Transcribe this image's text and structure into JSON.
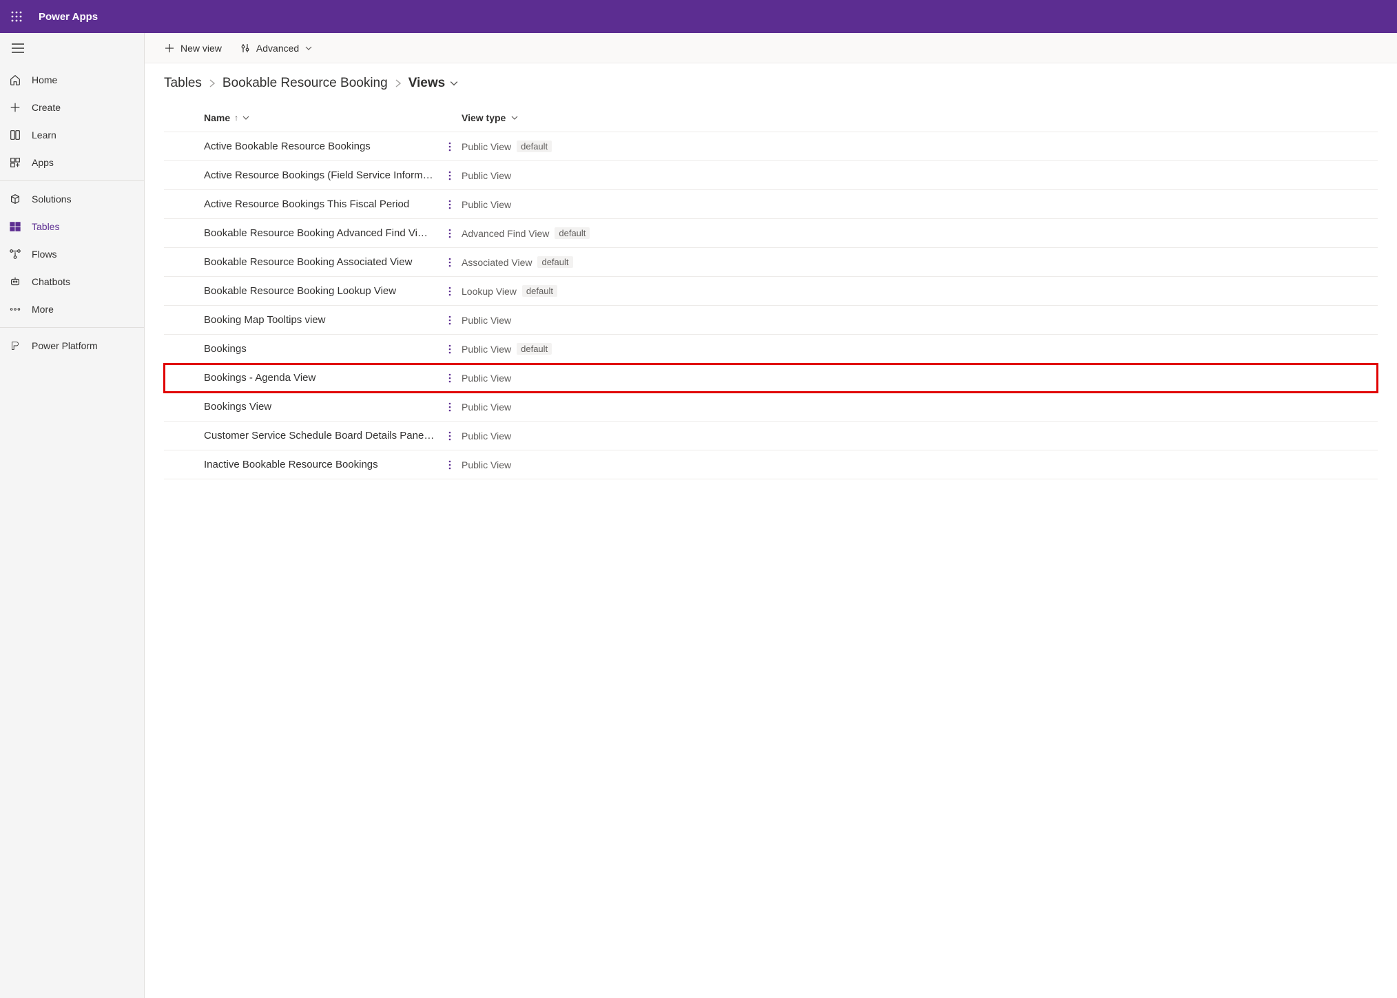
{
  "header": {
    "app_title": "Power Apps"
  },
  "nav": {
    "items": [
      {
        "label": "Home",
        "icon": "home"
      },
      {
        "label": "Create",
        "icon": "plus"
      },
      {
        "label": "Learn",
        "icon": "book"
      },
      {
        "label": "Apps",
        "icon": "grid-plus"
      }
    ],
    "items2": [
      {
        "label": "Solutions",
        "icon": "package"
      },
      {
        "label": "Tables",
        "icon": "tables",
        "active": true
      },
      {
        "label": "Flows",
        "icon": "flow"
      },
      {
        "label": "Chatbots",
        "icon": "bot"
      },
      {
        "label": "More",
        "icon": "more"
      }
    ],
    "items3": [
      {
        "label": "Power Platform",
        "icon": "platform"
      }
    ]
  },
  "commandbar": {
    "new_view": "New view",
    "advanced": "Advanced"
  },
  "breadcrumb": {
    "tables": "Tables",
    "entity": "Bookable Resource Booking",
    "current": "Views"
  },
  "grid": {
    "col_name": "Name",
    "col_type": "View type",
    "default_badge": "default",
    "rows": [
      {
        "name": "Active Bookable Resource Bookings",
        "type": "Public View",
        "default": true
      },
      {
        "name": "Active Resource Bookings (Field Service Inform…",
        "type": "Public View",
        "default": false
      },
      {
        "name": "Active Resource Bookings This Fiscal Period",
        "type": "Public View",
        "default": false
      },
      {
        "name": "Bookable Resource Booking Advanced Find Vi…",
        "type": "Advanced Find View",
        "default": true
      },
      {
        "name": "Bookable Resource Booking Associated View",
        "type": "Associated View",
        "default": true
      },
      {
        "name": "Bookable Resource Booking Lookup View",
        "type": "Lookup View",
        "default": true
      },
      {
        "name": "Booking Map Tooltips view",
        "type": "Public View",
        "default": false
      },
      {
        "name": "Bookings",
        "type": "Public View",
        "default": true
      },
      {
        "name": "Bookings - Agenda View",
        "type": "Public View",
        "default": false,
        "highlight": true
      },
      {
        "name": "Bookings View",
        "type": "Public View",
        "default": false
      },
      {
        "name": "Customer Service Schedule Board Details Pane…",
        "type": "Public View",
        "default": false
      },
      {
        "name": "Inactive Bookable Resource Bookings",
        "type": "Public View",
        "default": false
      }
    ]
  }
}
